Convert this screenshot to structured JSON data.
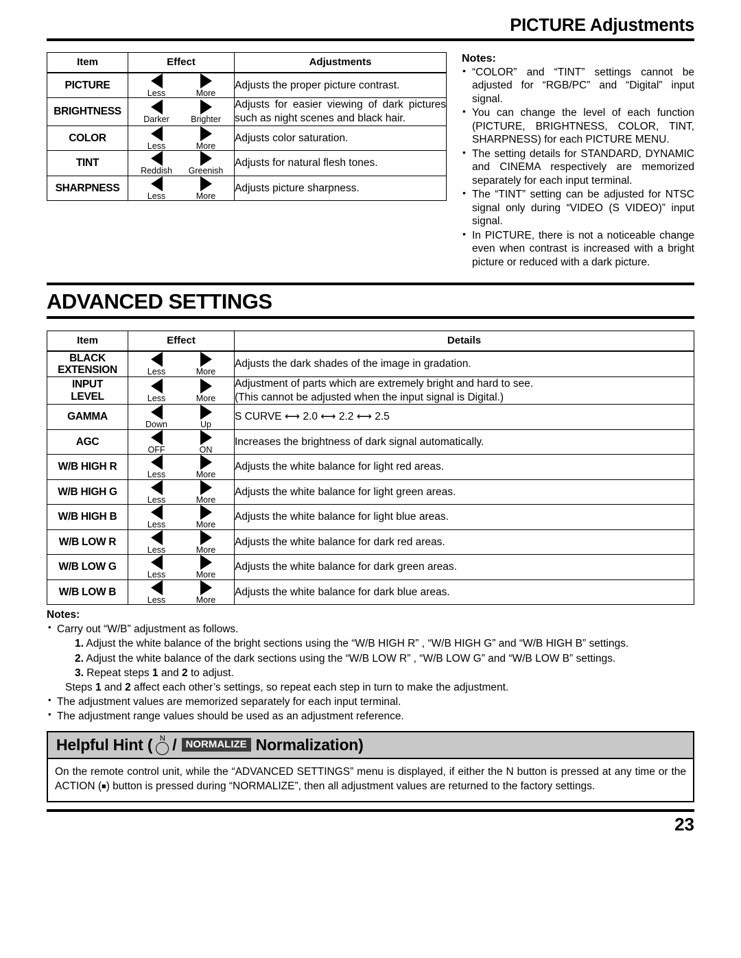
{
  "header": {
    "running_title": "PICTURE Adjustments"
  },
  "picture_table": {
    "columns": [
      "Item",
      "Effect",
      "Adjustments"
    ],
    "rows": [
      {
        "item": "PICTURE",
        "left_label": "Less",
        "right_label": "More",
        "desc": "Adjusts the proper picture contrast."
      },
      {
        "item": "BRIGHTNESS",
        "left_label": "Darker",
        "right_label": "Brighter",
        "desc": "Adjusts for easier viewing of dark pictures such as night scenes and black hair."
      },
      {
        "item": "COLOR",
        "left_label": "Less",
        "right_label": "More",
        "desc": "Adjusts color saturation."
      },
      {
        "item": "TINT",
        "left_label": "Reddish",
        "right_label": "Greenish",
        "desc": "Adjusts for natural flesh tones."
      },
      {
        "item": "SHARPNESS",
        "left_label": "Less",
        "right_label": "More",
        "desc": "Adjusts picture sharpness."
      }
    ]
  },
  "picture_notes": {
    "heading": "Notes:",
    "items": [
      "“COLOR” and “TINT” settings cannot be adjusted for “RGB/PC” and “Digital” input signal.",
      "You can change the level of each function (PICTURE, BRIGHTNESS, COLOR, TINT, SHARPNESS) for each PICTURE MENU.",
      "The setting details for STANDARD, DYNAMIC and CINEMA respectively are memorized separately for each input terminal.",
      "The “TINT” setting can be adjusted for NTSC signal only during “VIDEO (S VIDEO)” input signal.",
      "In PICTURE, there is not a noticeable change even when contrast is increased with a bright picture or reduced with a dark picture."
    ]
  },
  "advanced": {
    "title": "ADVANCED SETTINGS",
    "columns": [
      "Item",
      "Effect",
      "Details"
    ],
    "rows": [
      {
        "item": "BLACK\nEXTENSION",
        "left_label": "Less",
        "right_label": "More",
        "desc": "Adjusts the dark shades of the image in gradation."
      },
      {
        "item": "INPUT\nLEVEL",
        "left_label": "Less",
        "right_label": "More",
        "desc": "Adjustment of parts which are extremely bright and hard to see.\n(This cannot be adjusted when the input signal is Digital.)"
      },
      {
        "item": "GAMMA",
        "left_label": "Down",
        "right_label": "Up",
        "desc": "S CURVE ⟷ 2.0 ⟷ 2.2 ⟷ 2.5"
      },
      {
        "item": "AGC",
        "left_label": "OFF",
        "right_label": "ON",
        "desc": "Increases the brightness of dark signal automatically."
      },
      {
        "item": "W/B HIGH R",
        "left_label": "Less",
        "right_label": "More",
        "desc": "Adjusts the white balance for light red areas."
      },
      {
        "item": "W/B HIGH G",
        "left_label": "Less",
        "right_label": "More",
        "desc": "Adjusts the white balance for light green areas."
      },
      {
        "item": "W/B HIGH B",
        "left_label": "Less",
        "right_label": "More",
        "desc": "Adjusts the white balance for light blue areas."
      },
      {
        "item": "W/B LOW R",
        "left_label": "Less",
        "right_label": "More",
        "desc": "Adjusts the white balance for dark red areas."
      },
      {
        "item": "W/B LOW G",
        "left_label": "Less",
        "right_label": "More",
        "desc": "Adjusts the white balance for dark green areas."
      },
      {
        "item": "W/B LOW B",
        "left_label": "Less",
        "right_label": "More",
        "desc": "Adjusts the white balance for dark blue areas."
      }
    ]
  },
  "advanced_notes": {
    "heading": "Notes:",
    "bullet1": "Carry out “W/B” adjustment as follows.",
    "step1_num": "1.",
    "step1_text": "Adjust the white balance of the bright sections using the “W/B HIGH R” , “W/B HIGH G” and “W/B HIGH B” settings.",
    "step2_num": "2.",
    "step2_text": "Adjust the white balance of the dark sections using the “W/B LOW R” , “W/B LOW G” and “W/B LOW B” settings.",
    "step3_num": "3.",
    "step3_text_a": "Repeat steps ",
    "step3_b1": "1",
    "step3_text_b": " and ",
    "step3_b2": "2",
    "step3_text_c": " to adjust.",
    "tail_a": "Steps ",
    "tail_b1": "1",
    "tail_b": " and ",
    "tail_b2": "2",
    "tail_c": " affect each other’s settings, so repeat each step in turn to make the adjustment.",
    "bullet2": "The adjustment values are memorized separately for each input terminal.",
    "bullet3": "The adjustment range values should be used as an adjustment reference."
  },
  "helpful_hint": {
    "label": "Helpful Hint (",
    "knob_letter": "N",
    "slash": "/",
    "normalize_badge": "NORMALIZE",
    "title_tail": "Normalization)",
    "body_a": "On the remote control unit, while the “ADVANCED SETTINGS” menu is displayed, if either the N button is pressed at any time or the ACTION (",
    "body_square": "■",
    "body_b": ") button is pressed during “NORMALIZE”, then all adjustment values are returned to the factory settings."
  },
  "footer": {
    "page_number": "23"
  }
}
